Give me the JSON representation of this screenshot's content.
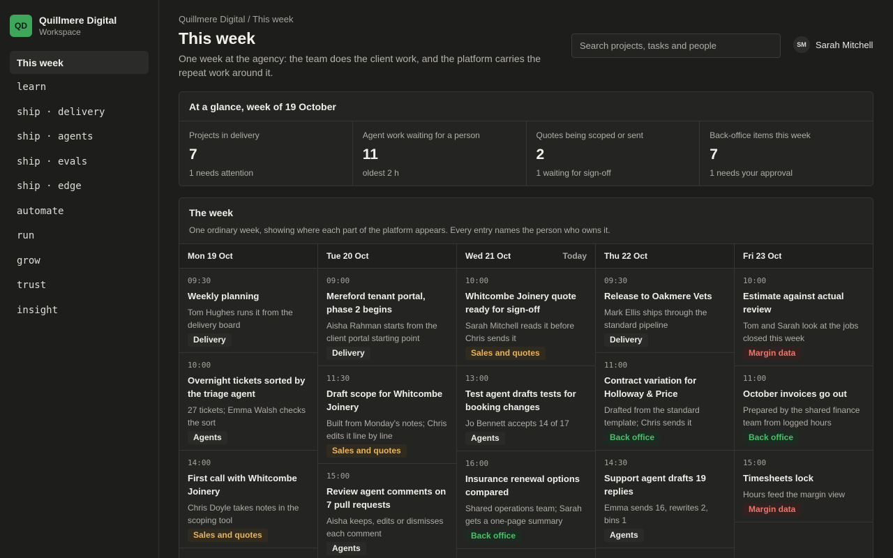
{
  "brand": {
    "initials": "QD",
    "name": "Quillmere Digital",
    "sub": "Workspace"
  },
  "nav": [
    {
      "label": "This week",
      "active": true
    },
    {
      "label": "learn"
    },
    {
      "label": "ship · delivery"
    },
    {
      "label": "ship · agents"
    },
    {
      "label": "ship · evals"
    },
    {
      "label": "ship · edge"
    },
    {
      "label": "automate"
    },
    {
      "label": "run"
    },
    {
      "label": "grow"
    },
    {
      "label": "trust"
    },
    {
      "label": "insight"
    }
  ],
  "header": {
    "breadcrumb": "Quillmere Digital / This week",
    "title": "This week",
    "subtitle": "One week at the agency: the team does the client work, and the platform carries the repeat work around it.",
    "search_placeholder": "Search projects, tasks and people",
    "user_initials": "SM",
    "user_name": "Sarah Mitchell"
  },
  "glance": {
    "title": "At a glance, week of 19 October",
    "stats": [
      {
        "label": "Projects in delivery",
        "value": "7",
        "note": "1 needs attention"
      },
      {
        "label": "Agent work waiting for a person",
        "value": "11",
        "note": "oldest 2 h"
      },
      {
        "label": "Quotes being scoped or sent",
        "value": "2",
        "note": "1 waiting for sign-off"
      },
      {
        "label": "Back-office items this week",
        "value": "7",
        "note": "1 needs your approval"
      }
    ]
  },
  "week": {
    "title": "The week",
    "description": "One ordinary week, showing where each part of the platform appears. Every entry names the person who owns it.",
    "days": [
      {
        "day": "Mon 19 Oct",
        "today": "",
        "entries": [
          {
            "time": "09:30",
            "title": "Weekly planning",
            "desc": "Tom Hughes runs it from the delivery board",
            "tag": "Delivery",
            "tag_kind": "delivery"
          },
          {
            "time": "10:00",
            "title": "Overnight tickets sorted by the triage agent",
            "desc": "27 tickets; Emma Walsh checks the sort",
            "tag": "Agents",
            "tag_kind": "agents"
          },
          {
            "time": "14:00",
            "title": "First call with Whitcombe Joinery",
            "desc": "Chris Doyle takes notes in the scoping tool",
            "tag": "Sales and quotes",
            "tag_kind": "sales"
          }
        ]
      },
      {
        "day": "Tue 20 Oct",
        "today": "",
        "entries": [
          {
            "time": "09:00",
            "title": "Mereford tenant portal, phase 2 begins",
            "desc": "Aisha Rahman starts from the client portal starting point",
            "tag": "Delivery",
            "tag_kind": "delivery"
          },
          {
            "time": "11:30",
            "title": "Draft scope for Whitcombe Joinery",
            "desc": "Built from Monday's notes; Chris edits it line by line",
            "tag": "Sales and quotes",
            "tag_kind": "sales"
          },
          {
            "time": "15:00",
            "title": "Review agent comments on 7 pull requests",
            "desc": "Aisha keeps, edits or dismisses each comment",
            "tag": "Agents",
            "tag_kind": "agents"
          }
        ]
      },
      {
        "day": "Wed 21 Oct",
        "today": "Today",
        "entries": [
          {
            "time": "10:00",
            "title": "Whitcombe Joinery quote ready for sign-off",
            "desc": "Sarah Mitchell reads it before Chris sends it",
            "tag": "Sales and quotes",
            "tag_kind": "sales"
          },
          {
            "time": "13:00",
            "title": "Test agent drafts tests for booking changes",
            "desc": "Jo Bennett accepts 14 of 17",
            "tag": "Agents",
            "tag_kind": "agents"
          },
          {
            "time": "16:00",
            "title": "Insurance renewal options compared",
            "desc": "Shared operations team; Sarah gets a one-page summary",
            "tag": "Back office",
            "tag_kind": "back"
          }
        ]
      },
      {
        "day": "Thu 22 Oct",
        "today": "",
        "entries": [
          {
            "time": "09:30",
            "title": "Release to Oakmere Vets",
            "desc": "Mark Ellis ships through the standard pipeline",
            "tag": "Delivery",
            "tag_kind": "delivery"
          },
          {
            "time": "11:00",
            "title": "Contract variation for Holloway & Price",
            "desc": "Drafted from the standard template; Chris sends it",
            "tag": "Back office",
            "tag_kind": "back"
          },
          {
            "time": "14:30",
            "title": "Support agent drafts 19 replies",
            "desc": "Emma sends 16, rewrites 2, bins 1",
            "tag": "Agents",
            "tag_kind": "agents"
          }
        ]
      },
      {
        "day": "Fri 23 Oct",
        "today": "",
        "entries": [
          {
            "time": "10:00",
            "title": "Estimate against actual review",
            "desc": "Tom and Sarah look at the jobs closed this week",
            "tag": "Margin data",
            "tag_kind": "margin"
          },
          {
            "time": "11:00",
            "title": "October invoices go out",
            "desc": "Prepared by the shared finance team from logged hours",
            "tag": "Back office",
            "tag_kind": "back"
          },
          {
            "time": "15:00",
            "title": "Timesheets lock",
            "desc": "Hours feed the margin view",
            "tag": "Margin data",
            "tag_kind": "margin"
          }
        ]
      }
    ]
  }
}
